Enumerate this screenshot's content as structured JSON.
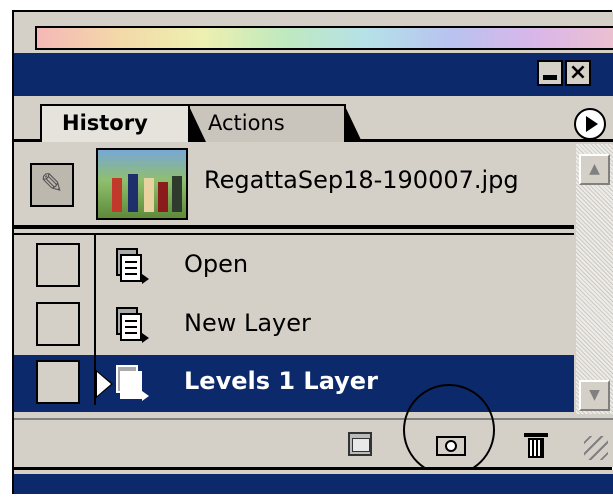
{
  "palette": {
    "panel_bg": "#d4d0c8",
    "title_bg": "#0c2a6b",
    "selected_bg": "#0c2a6b",
    "selected_text": "#ffffff"
  },
  "window": {
    "minimize_icon": "minimize-icon",
    "close_label": "×"
  },
  "tabs": [
    {
      "label": "History",
      "active": true
    },
    {
      "label": "Actions",
      "active": false
    }
  ],
  "snapshot": {
    "name": "RegattaSep18-190007.jpg",
    "icon": "history-brush-icon"
  },
  "history": [
    {
      "label": "Open",
      "icon": "history-state-icon",
      "selected": false
    },
    {
      "label": "New Layer",
      "icon": "history-state-icon",
      "selected": false
    },
    {
      "label": "Levels 1 Layer",
      "icon": "history-state-icon",
      "selected": true
    }
  ],
  "toolbar": {
    "buttons": [
      "new-document-icon",
      "camera-icon",
      "trash-icon"
    ]
  },
  "scroll": {
    "up_glyph": "▲",
    "down_glyph": "▼"
  }
}
